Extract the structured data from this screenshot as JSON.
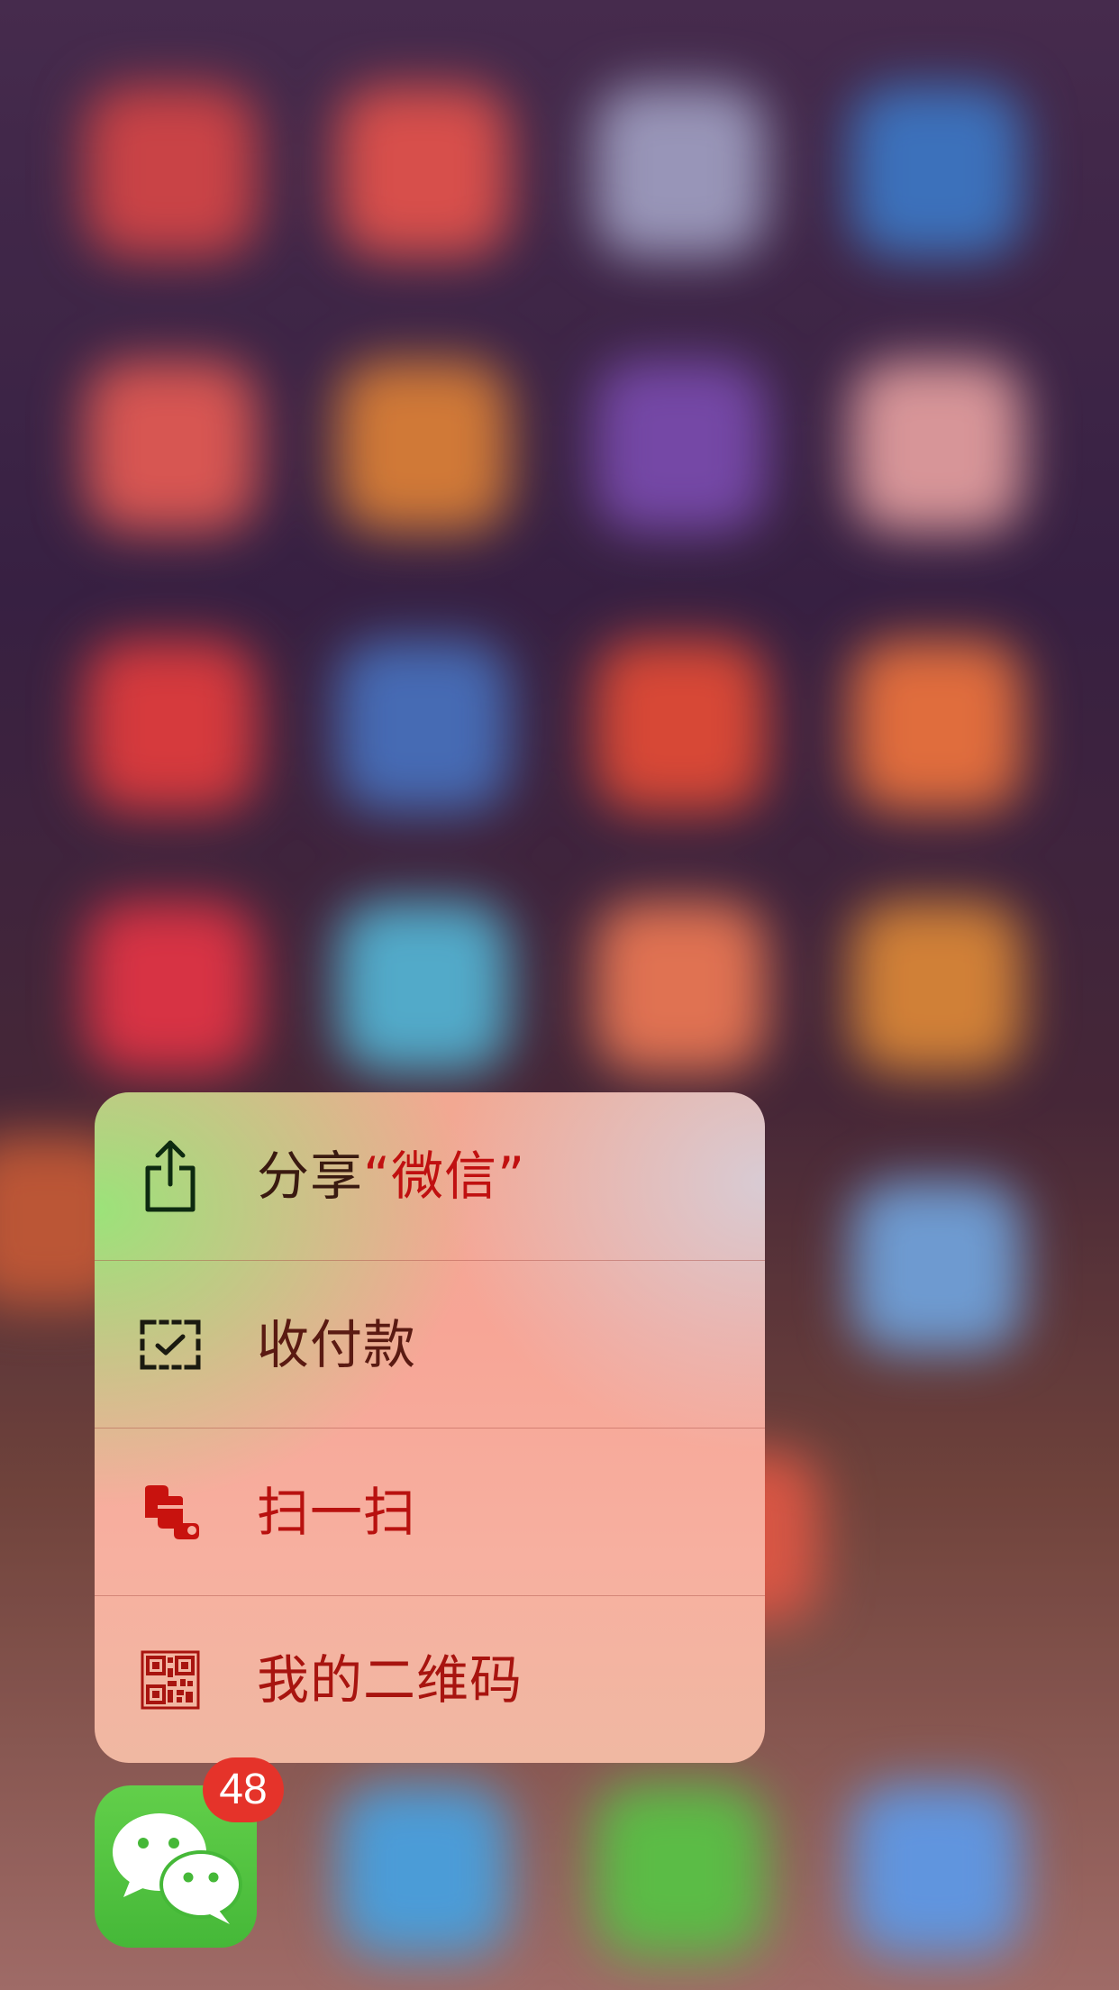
{
  "quick_actions": {
    "share": {
      "label_prefix": "分享",
      "label_app": "“微信”",
      "icon": "share-icon"
    },
    "payment": {
      "label": "收付款",
      "icon": "payment-scan-icon"
    },
    "scan": {
      "label": "扫一扫",
      "icon": "scan-icon"
    },
    "my_qr": {
      "label": "我的二维码",
      "icon": "qr-code-icon"
    }
  },
  "app": {
    "icon": "wechat-icon",
    "badge_count": "48",
    "brand_color": "#4cbf3e"
  },
  "colors": {
    "badge": "#e5332a",
    "menu_text_dark": "#3a1a10",
    "menu_text_red": "#b8110f"
  }
}
